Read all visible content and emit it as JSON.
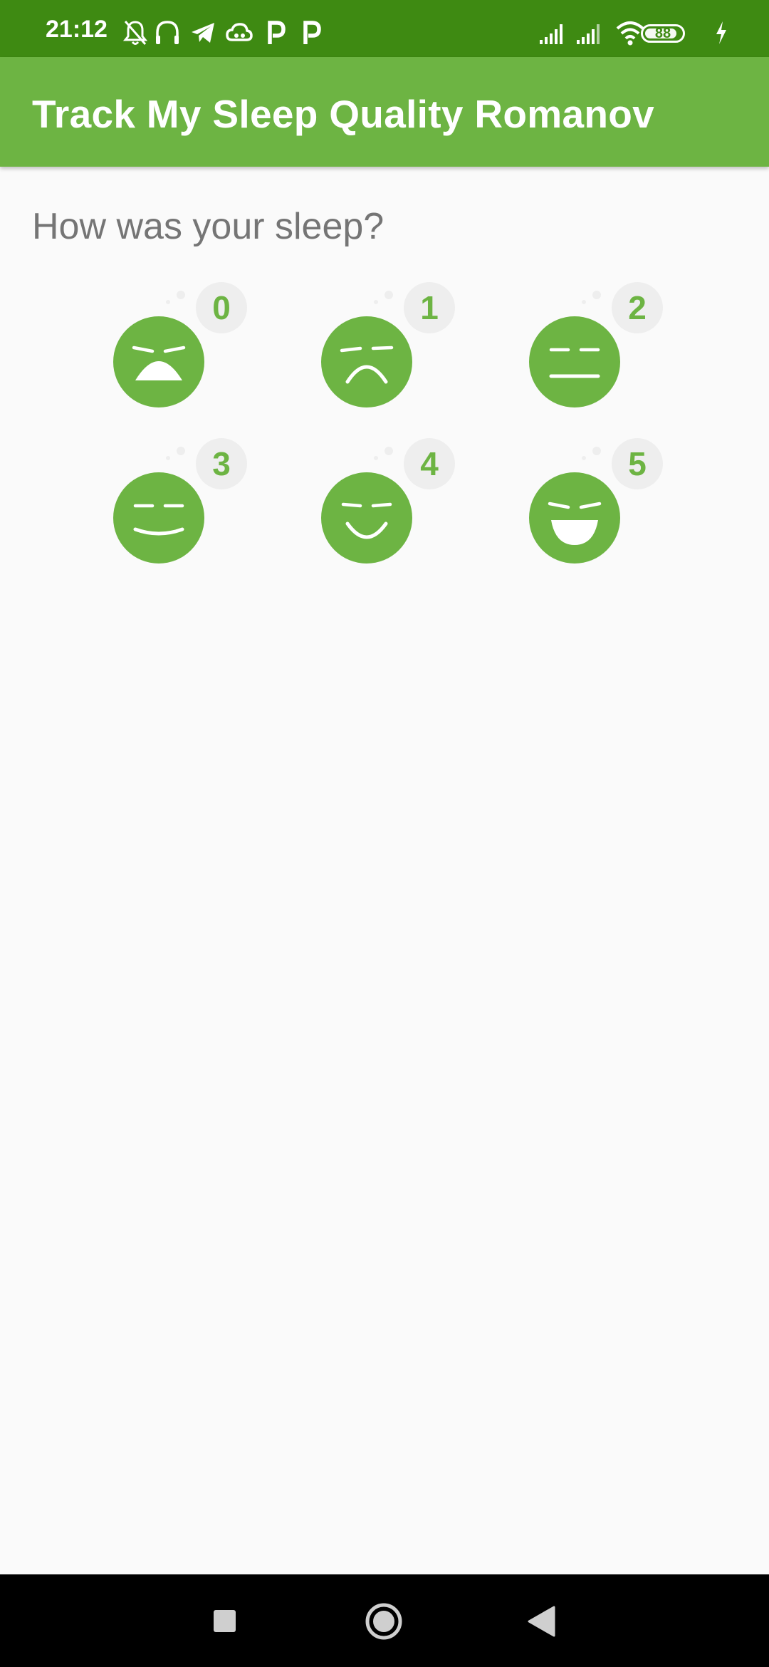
{
  "status_bar": {
    "time": "21:12",
    "battery_level": "88",
    "battery_fraction": 0.88,
    "icons": [
      "bell-off-icon",
      "headphones-icon",
      "telegram-icon",
      "cloud-icon",
      "parking-icon",
      "parking-icon",
      "signal-icon",
      "signal-icon",
      "wifi-icon",
      "battery-icon",
      "charging-icon"
    ]
  },
  "app_bar": {
    "title": "Track My Sleep Quality Romanov"
  },
  "content": {
    "question": "How was your sleep?",
    "faces": [
      {
        "label": "0",
        "icon": "sleep-face-0-icon"
      },
      {
        "label": "1",
        "icon": "sleep-face-1-icon"
      },
      {
        "label": "2",
        "icon": "sleep-face-2-icon"
      },
      {
        "label": "3",
        "icon": "sleep-face-3-icon"
      },
      {
        "label": "4",
        "icon": "sleep-face-4-icon"
      },
      {
        "label": "5",
        "icon": "sleep-face-5-icon"
      }
    ]
  },
  "navigation": {
    "buttons": [
      "recents-button",
      "home-button",
      "back-button"
    ]
  },
  "colors": {
    "status_bar": "#3E8A12",
    "app_bar": "#6DB443",
    "face": "#6DB443",
    "badge": "#EEEEEE",
    "background": "#FAFAFA",
    "question_text": "#757575"
  }
}
